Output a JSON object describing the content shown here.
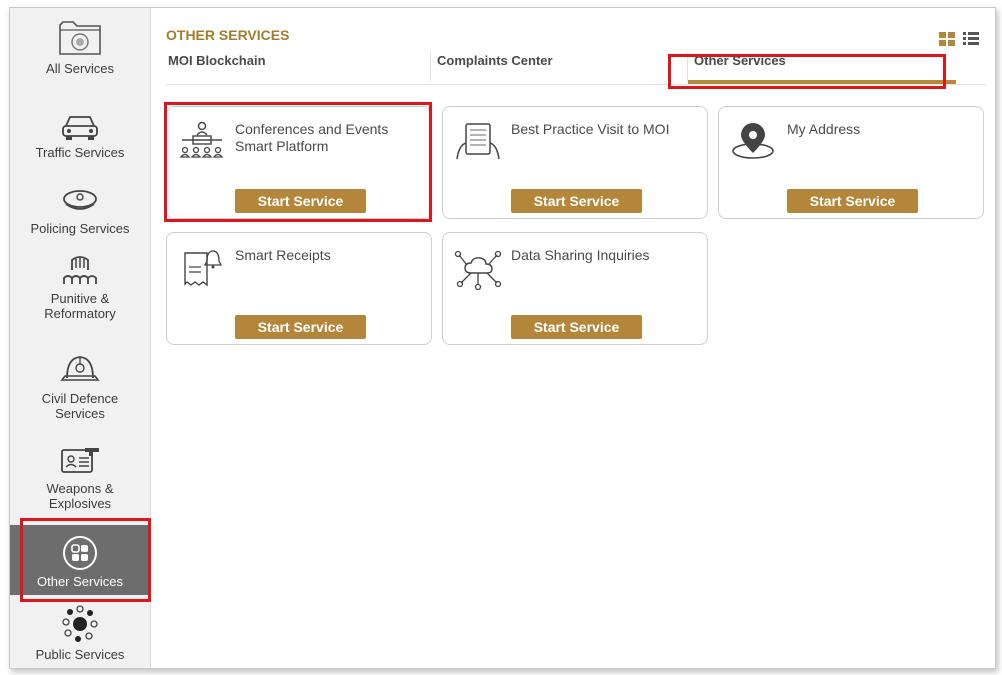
{
  "sidebar": {
    "items": [
      {
        "label": "All Services"
      },
      {
        "label": "Traffic Services"
      },
      {
        "label": "Policing Services"
      },
      {
        "label": "Punitive &",
        "label2": "Reformatory"
      },
      {
        "label": "Civil Defence",
        "label2": "Services"
      },
      {
        "label": "Weapons &",
        "label2": "Explosives"
      },
      {
        "label": "Other Services"
      },
      {
        "label": "Public Services"
      }
    ]
  },
  "header": {
    "title": "OTHER SERVICES"
  },
  "tabs": [
    {
      "label": "MOI Blockchain"
    },
    {
      "label": "Complaints Center"
    },
    {
      "label": "Other Services"
    }
  ],
  "cards": [
    {
      "title": "Conferences and Events Smart Platform",
      "button": "Start Service"
    },
    {
      "title": "Best Practice Visit to MOI",
      "button": "Start Service"
    },
    {
      "title": "My Address",
      "button": "Start Service"
    },
    {
      "title": "Smart Receipts",
      "button": "Start Service"
    },
    {
      "title": "Data Sharing Inquiries",
      "button": "Start Service"
    }
  ],
  "colors": {
    "accent": "#b3863a",
    "title": "#a67c2a",
    "highlight": "#e0141b",
    "active_sidebar": "#6d6d6d"
  },
  "icons": {
    "grid_view": "grid-view-icon",
    "list_view": "list-view-icon"
  }
}
